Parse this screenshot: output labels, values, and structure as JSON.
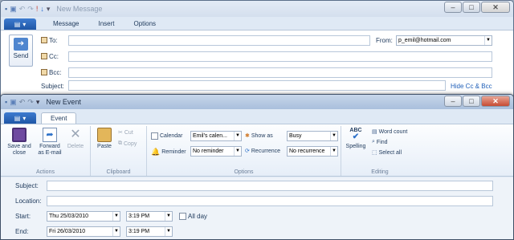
{
  "message": {
    "title": "New Message",
    "tabs": [
      "Message",
      "Insert",
      "Options"
    ],
    "send_label": "Send",
    "to_label": "To:",
    "cc_label": "Cc:",
    "bcc_label": "Bcc:",
    "subject_label": "Subject:",
    "from_label": "From:",
    "from_value": "p_emil@hotmail.com",
    "hide_cc_bcc": "Hide Cc & Bcc"
  },
  "event": {
    "title": "New Event",
    "tab": "Event",
    "actions": {
      "save_close": "Save and close",
      "forward": "Forward as E-mail",
      "delete": "Delete",
      "group": "Actions"
    },
    "clipboard": {
      "paste": "Paste",
      "cut": "Cut",
      "copy": "Copy",
      "group": "Clipboard"
    },
    "options": {
      "calendar_label": "Calendar",
      "calendar_value": "Emil's calen...",
      "reminder_label": "Reminder",
      "reminder_value": "No reminder",
      "showas_label": "Show as",
      "showas_value": "Busy",
      "recurrence_label": "Recurrence",
      "recurrence_value": "No recurrence",
      "group": "Options"
    },
    "editing": {
      "spelling": "Spelling",
      "word_count": "Word count",
      "find": "Find",
      "select_all": "Select all",
      "group": "Editing"
    },
    "form": {
      "subject_label": "Subject:",
      "location_label": "Location:",
      "start_label": "Start:",
      "start_date": "Thu 25/03/2010",
      "start_time": "3:19 PM",
      "allday_label": "All day",
      "end_label": "End:",
      "end_date": "Fri 26/03/2010",
      "end_time": "3:19 PM"
    }
  }
}
